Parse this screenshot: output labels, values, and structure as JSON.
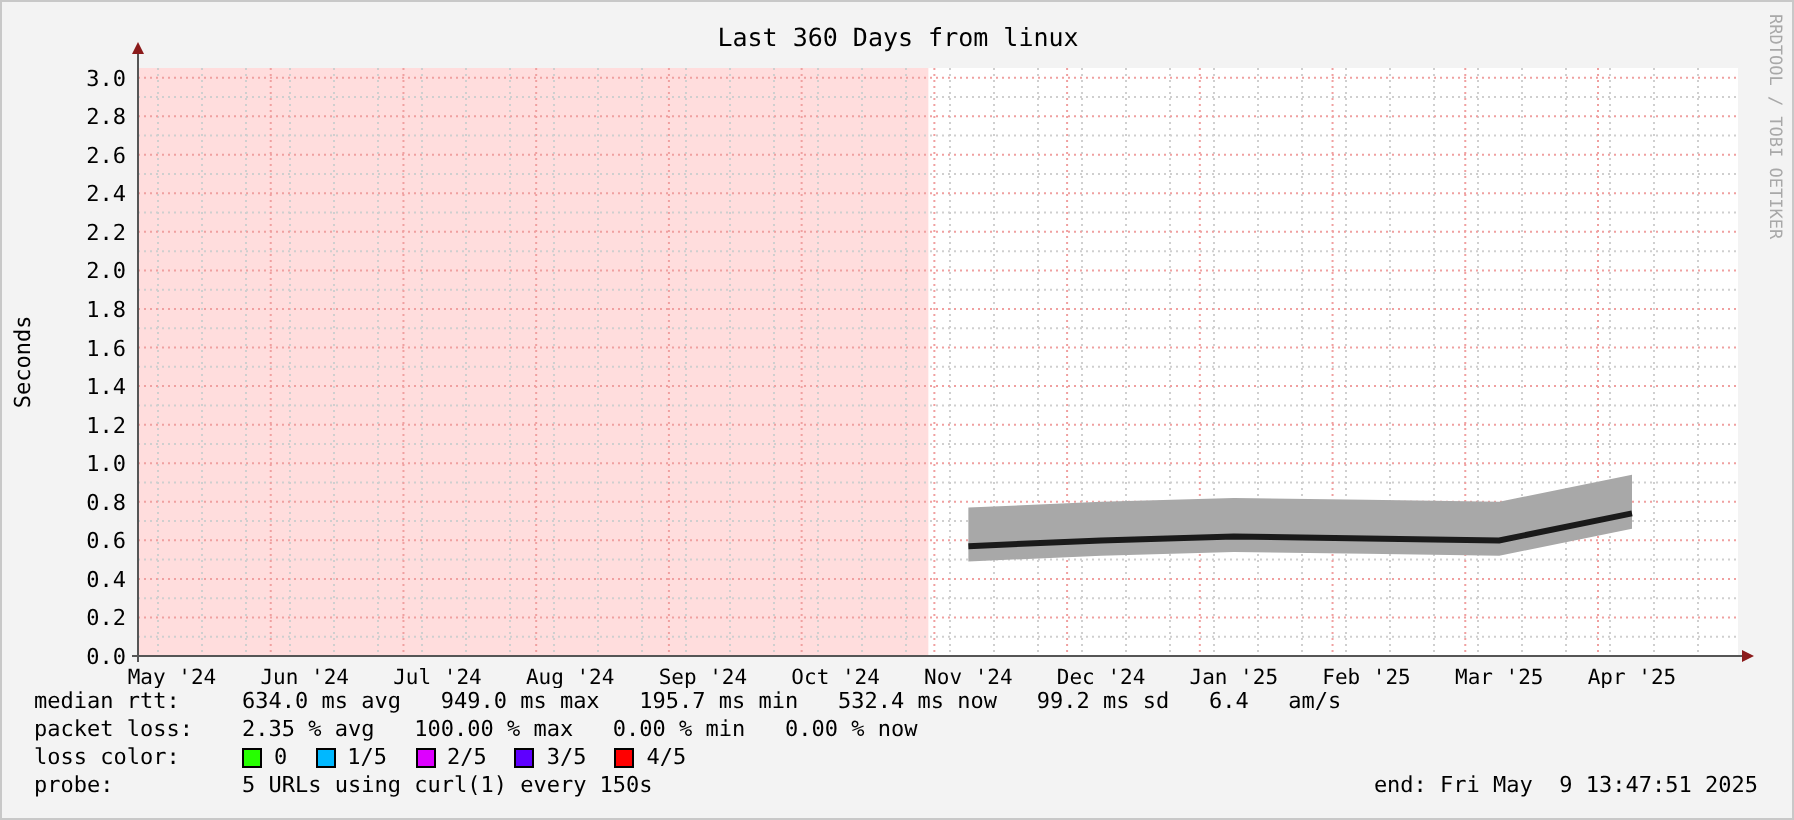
{
  "chart_data": {
    "type": "line",
    "grid": true,
    "title": "Last 360 Days from linux",
    "ylabel": "Seconds",
    "ylim": [
      0,
      3.05
    ],
    "categories": [
      "May '24",
      "Jun '24",
      "Jul '24",
      "Aug '24",
      "Sep '24",
      "Oct '24",
      "Nov '24",
      "Dec '24",
      "Jan '25",
      "Feb '25",
      "Mar '25",
      "Apr '25"
    ],
    "series": [
      {
        "color": "#1a1a1a",
        "values": [
          null,
          null,
          null,
          null,
          null,
          null,
          0.57,
          0.6,
          0.62,
          0.61,
          0.6,
          0.74
        ]
      }
    ],
    "yticks": [
      {
        "value": 0,
        "label": "0.0"
      },
      {
        "value": 0.2,
        "label": "0.2"
      },
      {
        "value": 0.4,
        "label": "0.4"
      },
      {
        "value": 0.6,
        "label": "0.6"
      },
      {
        "value": 0.8,
        "label": "0.8"
      },
      {
        "value": 1,
        "label": "1.0"
      },
      {
        "value": 1.2,
        "label": "1.2"
      },
      {
        "value": 1.4,
        "label": "1.4"
      },
      {
        "value": 1.6,
        "label": "1.6"
      },
      {
        "value": 1.8,
        "label": "1.8"
      },
      {
        "value": 2,
        "label": "2.0"
      },
      {
        "value": 2.2,
        "label": "2.2"
      },
      {
        "value": 2.4,
        "label": "2.4"
      },
      {
        "value": 2.6,
        "label": "2.6"
      },
      {
        "value": 2.8,
        "label": "2.8"
      },
      {
        "value": 3,
        "label": "3.0"
      }
    ]
  },
  "watermark_side": "RRDTOOL / TOBI OETIKER",
  "legend": [
    {
      "label": "median rtt:",
      "text": "634.0 ms avg   949.0 ms max   195.7 ms min   532.4 ms now   99.2 ms sd   6.4   am/s"
    },
    {
      "label": "packet loss:",
      "text": "2.35 % avg   100.00 % max   0.00 % min   0.00 % now"
    }
  ],
  "loss_color": {
    "label": "loss color:",
    "items": [
      {
        "label": "0",
        "color": "#26ff00"
      },
      {
        "label": "1/5",
        "color": "#00b8ff"
      },
      {
        "label": "2/5",
        "color": "#dd00ff"
      },
      {
        "label": "3/5",
        "color": "#5e00ff"
      },
      {
        "label": "4/5",
        "color": "#ff0000"
      }
    ]
  },
  "probe": {
    "label": "probe:",
    "text": "5 URLs using curl(1) every 150s"
  },
  "end": "end: Fri May  9 13:47:51 2025"
}
